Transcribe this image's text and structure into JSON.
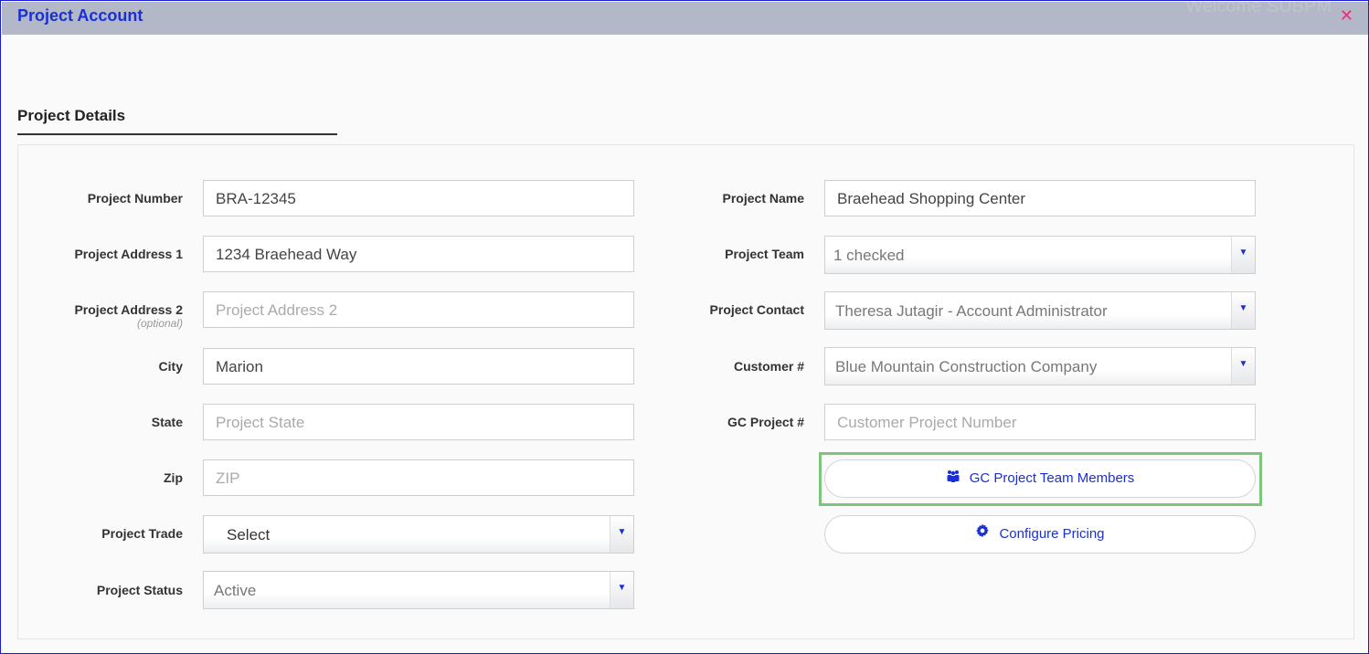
{
  "window": {
    "title": "Project Account",
    "welcome": "Welcome SUBPM",
    "close_icon": "close-icon"
  },
  "section": {
    "title": "Project Details"
  },
  "left": {
    "project_number": {
      "label": "Project Number",
      "value": "BRA-12345"
    },
    "project_address1": {
      "label": "Project Address 1",
      "value": "1234 Braehead Way"
    },
    "project_address2": {
      "label": "Project Address 2",
      "sublabel": "(optional)",
      "placeholder": "Project Address 2"
    },
    "city": {
      "label": "City",
      "value": "Marion"
    },
    "state": {
      "label": "State",
      "placeholder": "Project State"
    },
    "zip": {
      "label": "Zip",
      "placeholder": "ZIP"
    },
    "project_trade": {
      "label": "Project Trade",
      "value": "Select"
    },
    "project_status": {
      "label": "Project Status",
      "value": "Active"
    }
  },
  "right": {
    "project_name": {
      "label": "Project Name",
      "value": "Braehead Shopping Center"
    },
    "project_team": {
      "label": "Project Team",
      "value": "1 checked"
    },
    "project_contact": {
      "label": "Project Contact",
      "value": "Theresa Jutagir - Account Administrator"
    },
    "customer": {
      "label": "Customer #",
      "value": "Blue Mountain Construction Company"
    },
    "gc_project": {
      "label": "GC Project #",
      "placeholder": "Customer Project Number"
    },
    "gc_team_button": {
      "label": "GC Project Team Members",
      "icon": "group-icon"
    },
    "pricing_button": {
      "label": "Configure Pricing",
      "icon": "gear-icon"
    }
  },
  "colors": {
    "accent": "#1a2fd6",
    "highlight": "#7dc47d",
    "close": "#e0337a"
  }
}
